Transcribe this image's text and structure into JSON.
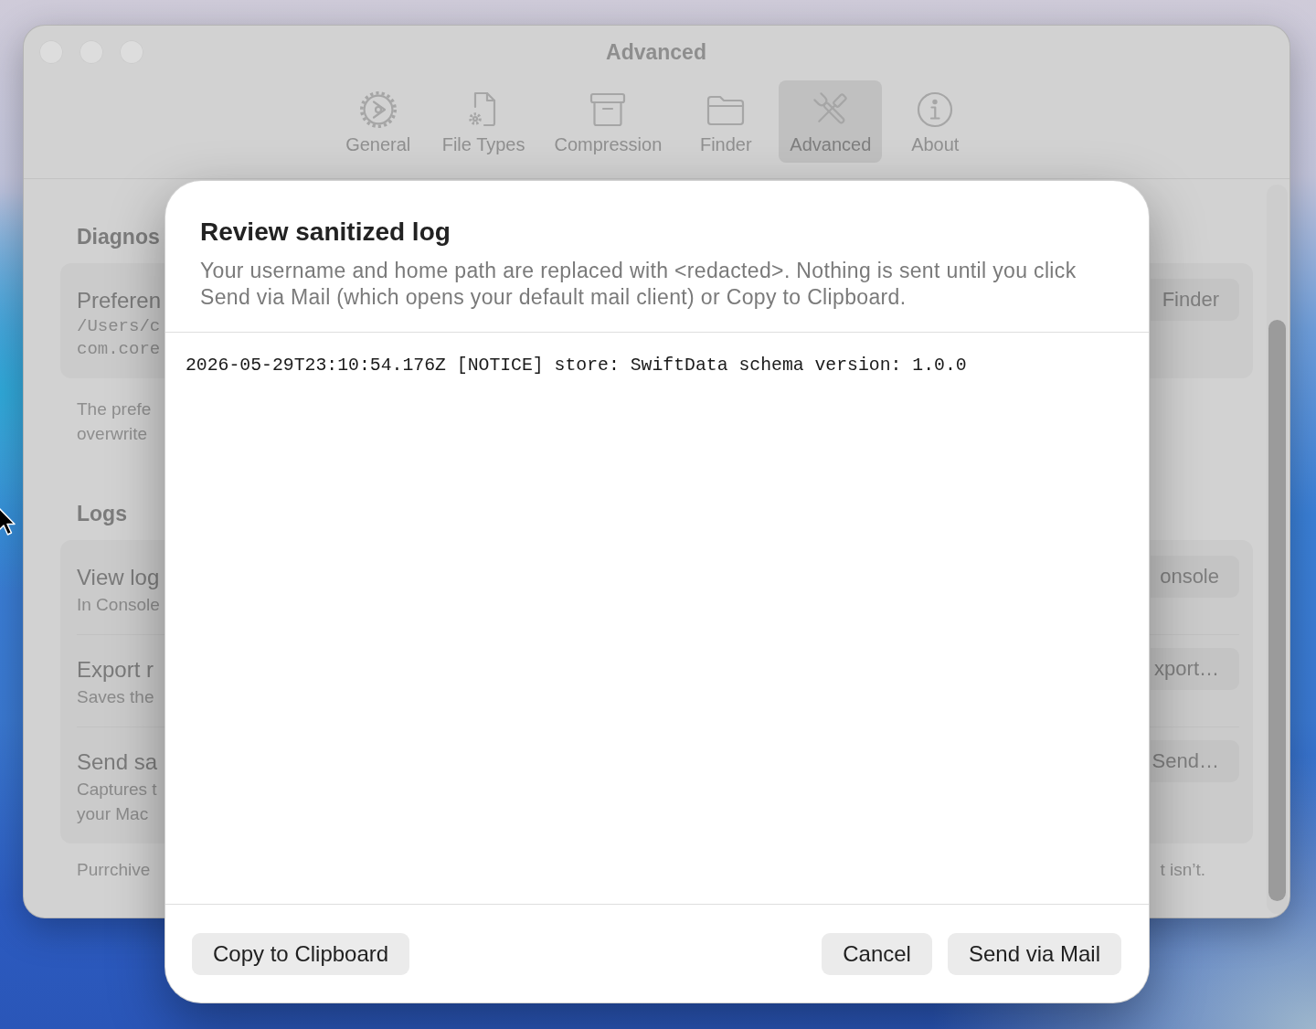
{
  "window": {
    "title": "Advanced"
  },
  "toolbar": {
    "tabs": [
      {
        "label": "General",
        "selected": false
      },
      {
        "label": "File Types",
        "selected": false
      },
      {
        "label": "Compression",
        "selected": false
      },
      {
        "label": "Finder",
        "selected": false
      },
      {
        "label": "Advanced",
        "selected": true
      },
      {
        "label": "About",
        "selected": false
      }
    ]
  },
  "sections": [
    {
      "heading": "Diagnos",
      "rows": [
        {
          "kind": "path",
          "title": "Preferen",
          "details": [
            "/Users/c",
            "com.core"
          ],
          "button": "Finder"
        }
      ],
      "note_lines": [
        "The prefe",
        "overwrite"
      ]
    },
    {
      "heading": "Logs",
      "rows": [
        {
          "kind": "text",
          "title": "View log",
          "details": [
            "In Console"
          ],
          "button": "onsole"
        },
        {
          "kind": "text",
          "title": "Export r",
          "details": [
            "Saves the"
          ],
          "button": "xport…"
        },
        {
          "kind": "text",
          "title": "Send sa",
          "details": [
            "Captures t",
            "your Mac"
          ],
          "button": "Send…"
        }
      ],
      "footer": {
        "left": "Purrchive",
        "right": "t isn’t."
      }
    }
  ],
  "dialog": {
    "title": "Review sanitized log",
    "message": "Your username and home path are replaced with <redacted>. Nothing is sent until you click Send via Mail (which opens your default mail client) or Copy to Clipboard.",
    "log_lines": [
      "2026-05-29T23:10:54.176Z [NOTICE] store: SwiftData schema version: 1.0.0"
    ],
    "leading_button": "Copy to Clipboard",
    "trailing_buttons": [
      "Cancel",
      "Send via Mail"
    ]
  }
}
